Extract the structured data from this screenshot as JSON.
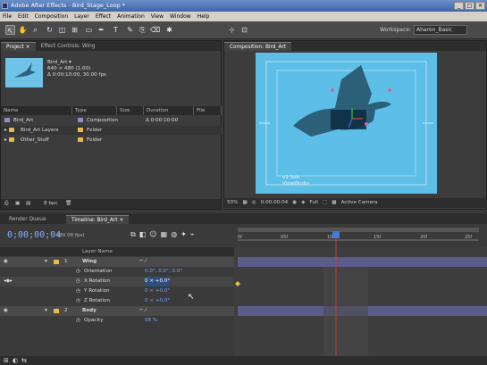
{
  "window": {
    "title": "Adobe After Effects - Bird_Stage_Loop *",
    "buttons": [
      "_",
      "□",
      "✕"
    ]
  },
  "menu": [
    "File",
    "Edit",
    "Composition",
    "Layer",
    "Effect",
    "Animation",
    "View",
    "Window",
    "Help"
  ],
  "toolbar": {
    "workspace_label": "Workspace:",
    "workspace_value": "Aharon_Basic"
  },
  "project_panel": {
    "tabs": [
      "Project ×",
      "Effect Controls: Wing"
    ],
    "item_name": "Bird_Art ▾",
    "item_size": "640 × 480 (1.00)",
    "item_duration": "Δ 0:00:10:00, 30.00 fps",
    "columns": [
      "Name",
      "Type",
      "Size",
      "Duration",
      "File"
    ],
    "rows": [
      {
        "name": "Bird_Art",
        "type": "Composition",
        "size": "",
        "duration": "Δ 0:00:10:00",
        "kind": "comp",
        "color": "#8f8fc8"
      },
      {
        "name": "Bird_Art Layers",
        "type": "Folder",
        "size": "",
        "duration": "",
        "kind": "folder",
        "color": "#e6b84e"
      },
      {
        "name": "Other_Stuff",
        "type": "Folder",
        "size": "",
        "duration": "",
        "kind": "folder",
        "color": "#e6b84e"
      }
    ],
    "footer_bpc": "8 bpc"
  },
  "comp_panel": {
    "tab": "Composition: Bird_Art",
    "watermark_line1": "v9 Sob",
    "watermark_line2": "ViewWorks",
    "footer": {
      "zoom": "50%",
      "timecode": "0:00:00:04",
      "resolution": "Full",
      "camera": "Active Camera"
    }
  },
  "timeline": {
    "tabs": [
      "Render Queue",
      "Timeline: Bird_Art ×"
    ],
    "current_time": "0;00;00;04",
    "fps": "(30.00 fps)",
    "layer_name_header": "Layer Name",
    "ruler_marks": [
      "0f",
      "05f",
      "10f",
      "15f",
      "20f",
      "25f"
    ],
    "layers": [
      {
        "num": "1",
        "name": "Wing",
        "label_color": "#e6b84e",
        "properties": [
          {
            "name": "Orientation",
            "value": "0.0°, 0.0°, 0.0°"
          },
          {
            "name": "X Rotation",
            "value": "0 × +0.0°",
            "editing": true
          },
          {
            "name": "Y Rotation",
            "value": "0 × +0.0°"
          },
          {
            "name": "Z Rotation",
            "value": "0 × +0.0°"
          }
        ]
      },
      {
        "num": "2",
        "name": "Body",
        "label_color": "#e6b84e",
        "properties": [
          {
            "name": "Opacity",
            "value": "58 %"
          }
        ]
      }
    ]
  },
  "colors": {
    "canvas_blue": "#5dbfe8",
    "bird": "#2c5f78",
    "timecode_blue": "#7fb3ff",
    "cti_red": "#d03838"
  }
}
